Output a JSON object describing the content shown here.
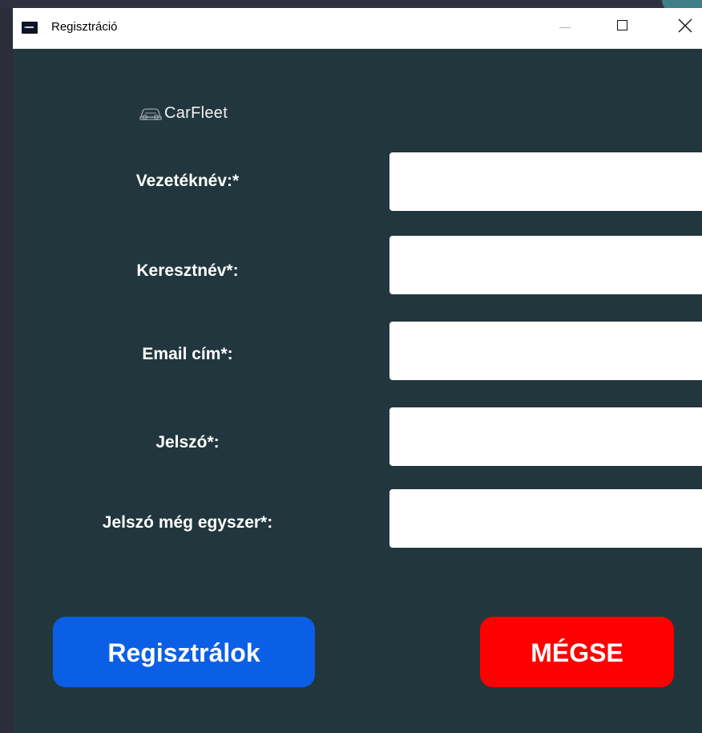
{
  "window": {
    "title": "Regisztráció",
    "app_icon": "carfleet-app-icon",
    "controls": [
      "minimize-icon",
      "maximize-icon",
      "close-icon"
    ]
  },
  "logo": {
    "icon": "car-icon",
    "text": "CarFleet"
  },
  "form": {
    "last_name": {
      "label": "Vezetéknév:*",
      "value": ""
    },
    "first_name": {
      "label": "Keresztnév*:",
      "value": ""
    },
    "email": {
      "label": "Email cím*:",
      "value": ""
    },
    "password": {
      "label": "Jelszó*:",
      "value": ""
    },
    "password_confirm": {
      "label": "Jelszó még egyszer*:",
      "value": ""
    }
  },
  "buttons": {
    "register": "Regisztrálok",
    "cancel": "MÉGSE"
  },
  "colors": {
    "background": "#21363d",
    "register_button": "#0b5fe6",
    "cancel_button": "#fe0000",
    "text": "#ffffff"
  }
}
